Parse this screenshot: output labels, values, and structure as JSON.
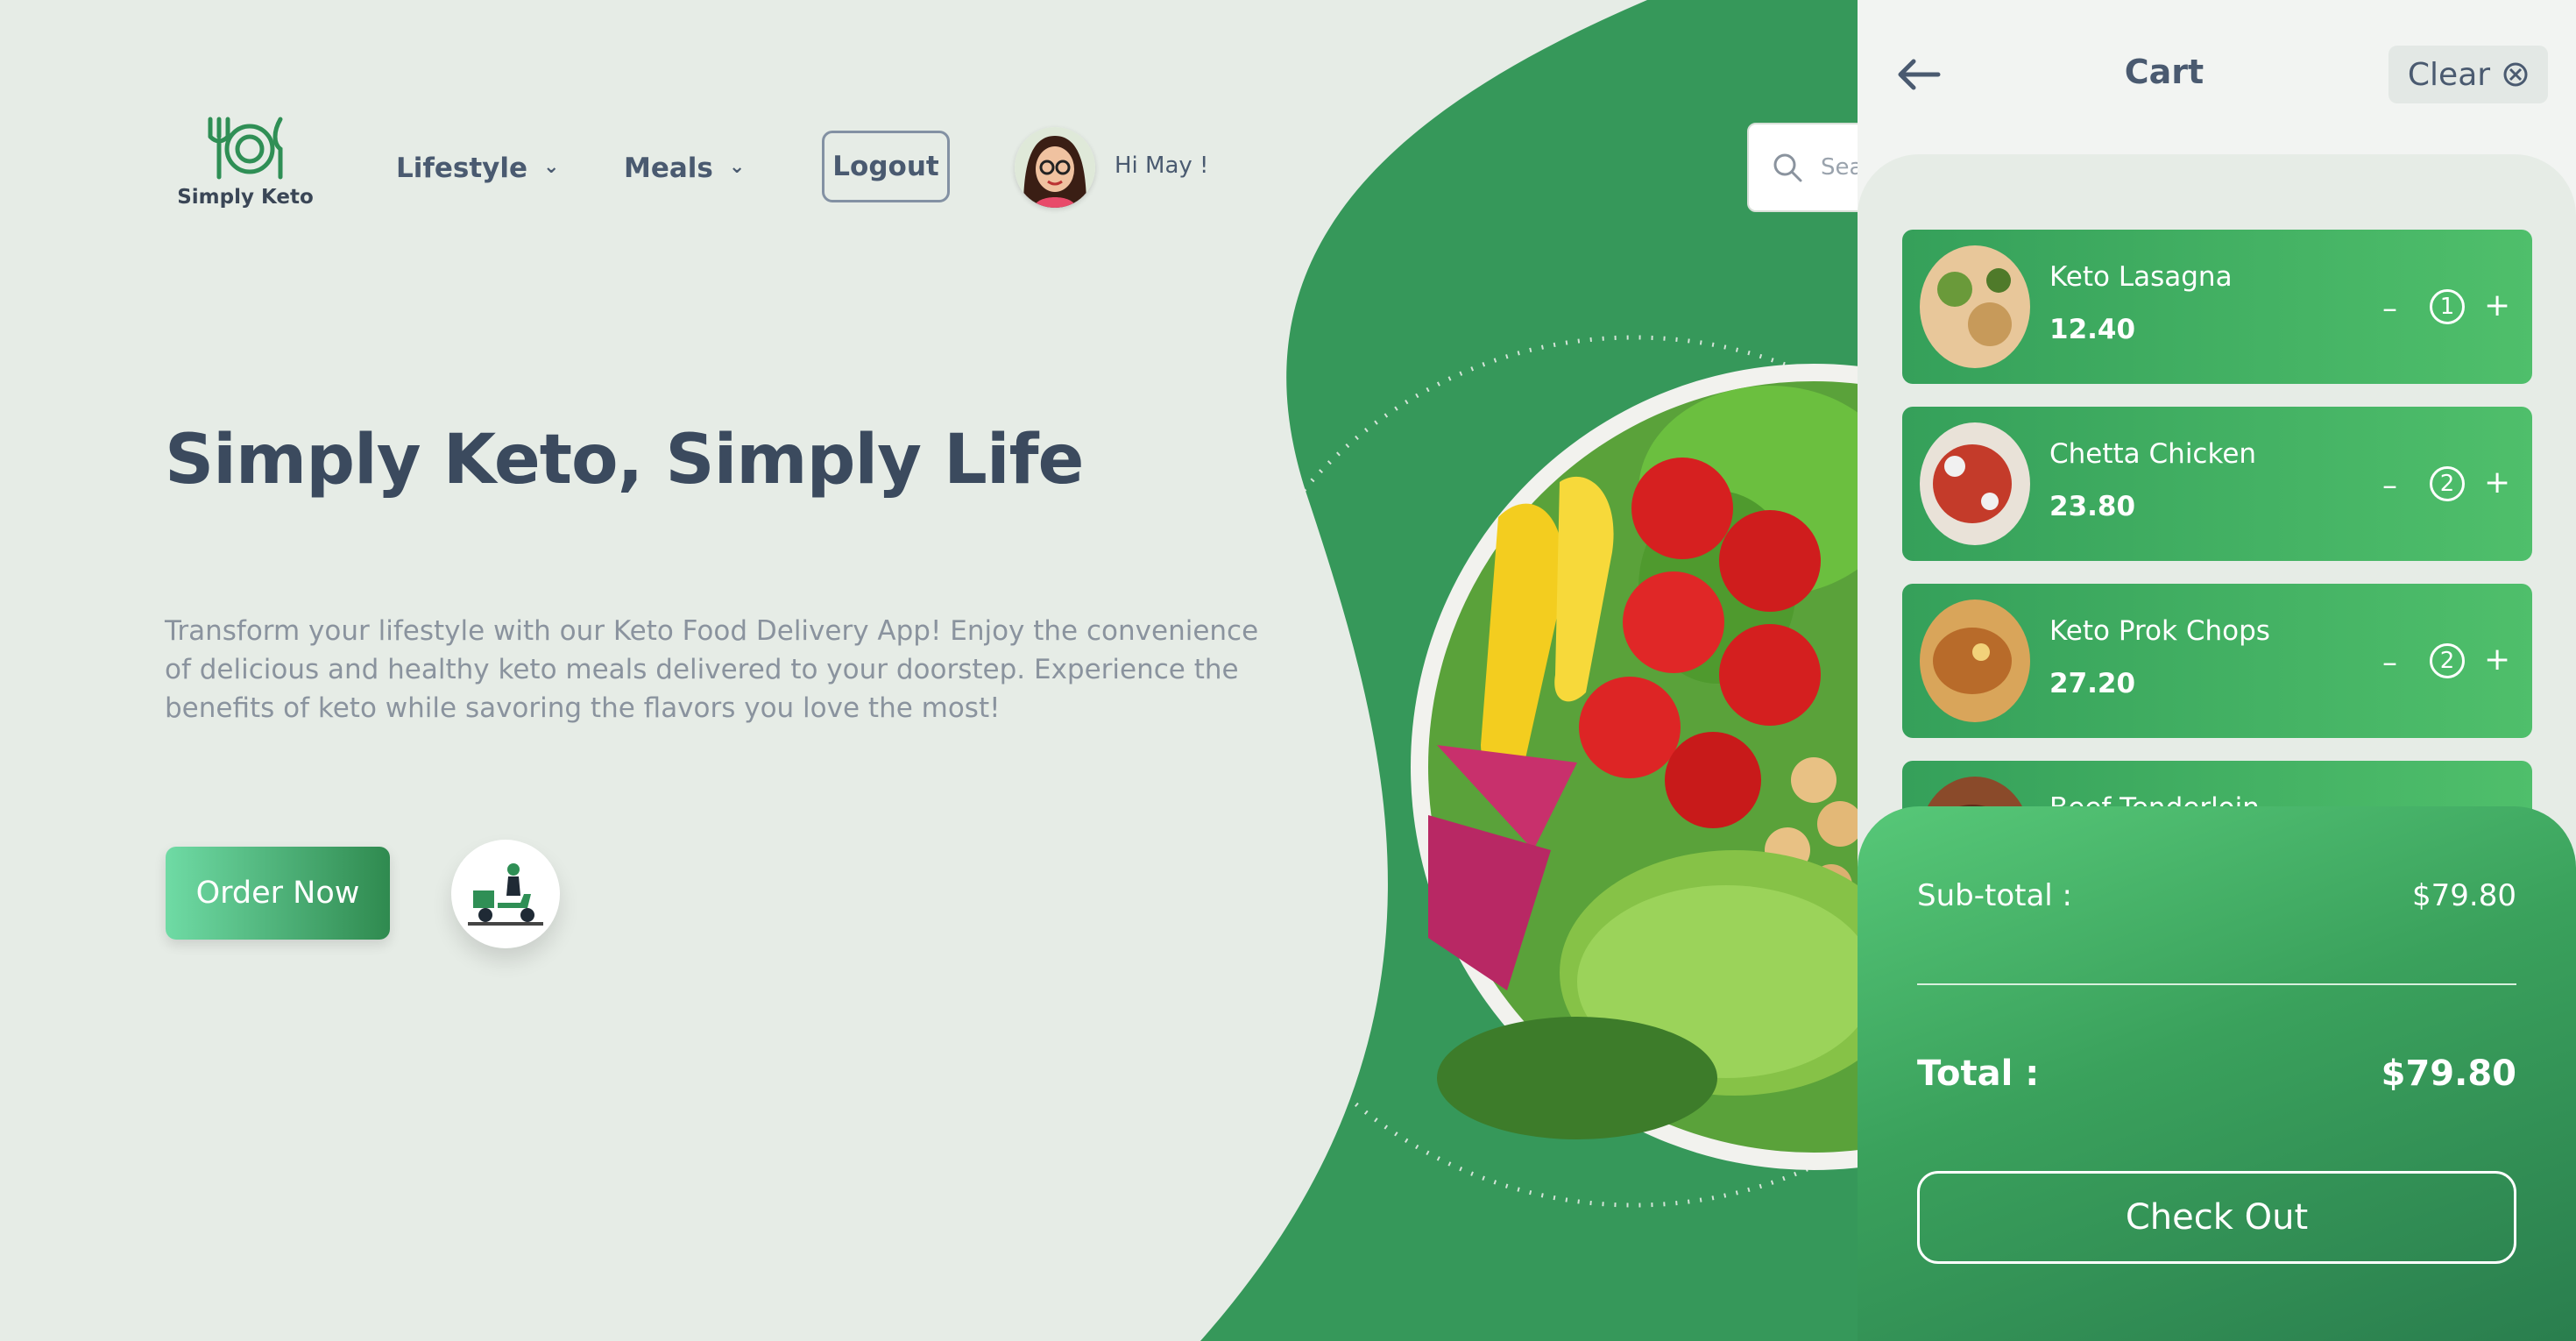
{
  "brand": {
    "name": "Simply Keto"
  },
  "nav": {
    "items": [
      {
        "label": "Lifestyle",
        "icon": "chevron-down-icon"
      },
      {
        "label": "Meals",
        "icon": "chevron-down-icon"
      }
    ],
    "logout_label": "Logout",
    "greeting": "Hi May !",
    "search_placeholder": "Search"
  },
  "hero": {
    "title": "Simply Keto, Simply Life",
    "description": "Transform your lifestyle with our Keto Food Delivery App! Enjoy the convenience of delicious and healthy keto meals delivered to your doorstep. Experience the benefits of keto while savoring the flavors you love the most!",
    "cta_label": "Order Now"
  },
  "cart": {
    "title": "Cart",
    "clear_label": "Clear",
    "items": [
      {
        "name": "Keto Lasagna",
        "price": "12.40",
        "qty": "1"
      },
      {
        "name": "Chetta Chicken",
        "price": "23.80",
        "qty": "2"
      },
      {
        "name": "Keto Prok Chops",
        "price": "27.20",
        "qty": "2"
      },
      {
        "name": "Beef Tenderloin",
        "price": "",
        "qty": ""
      }
    ],
    "subtotal_label": "Sub-total :",
    "subtotal_value": "$79.80",
    "total_label": "Total :",
    "total_value": "$79.80",
    "checkout_label": "Check Out"
  },
  "colors": {
    "primary_green": "#36a05a",
    "background": "#e6ece6",
    "text_dark": "#3b4a5e"
  }
}
